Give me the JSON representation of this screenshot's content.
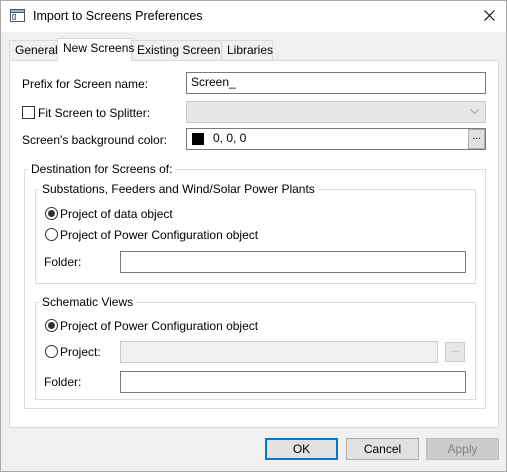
{
  "window": {
    "title": "Import to Screens Preferences"
  },
  "tabs": [
    {
      "label": "General",
      "active": false
    },
    {
      "label": "New Screens",
      "active": true
    },
    {
      "label": "Existing Screens",
      "active": false
    },
    {
      "label": "Libraries",
      "active": false
    }
  ],
  "form": {
    "prefix_label": "Prefix for Screen name:",
    "prefix_value": "Screen_",
    "fit_label": "Fit Screen to Splitter:",
    "fit_checked": false,
    "bgcolor_label": "Screen's background color:",
    "bgcolor_value": "0, 0, 0",
    "bgcolor_swatch": "#000000",
    "browse_label": "..."
  },
  "destination": {
    "title": "Destination for Screens of:",
    "substations": {
      "title": "Substations, Feeders and Wind/Solar Power Plants",
      "option1": "Project of data object",
      "option2": "Project of Power Configuration object",
      "selected": "option1",
      "folder_label": "Folder:",
      "folder_value": ""
    },
    "schematic": {
      "title": "Schematic Views",
      "option1": "Project of Power Configuration object",
      "option2": "Project:",
      "selected": "option1",
      "project_value": "",
      "project_browse_label": "...",
      "folder_label": "Folder:",
      "folder_value": ""
    }
  },
  "buttons": {
    "ok": "OK",
    "cancel": "Cancel",
    "apply": "Apply"
  },
  "colors": {
    "focus_accent": "#0078d7",
    "dialog_bg": "#f0f0f0"
  }
}
